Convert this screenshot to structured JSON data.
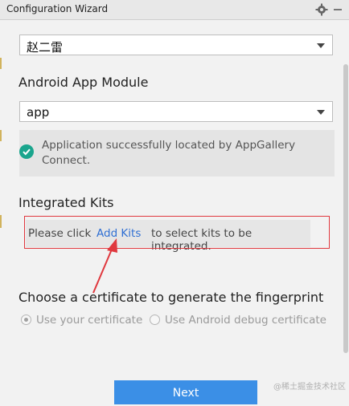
{
  "window": {
    "title": "Configuration Wizard"
  },
  "developer_select": {
    "value": "赵二雷"
  },
  "module": {
    "label": "Android App Module",
    "value": "app"
  },
  "notice": {
    "text": "Application successfully located by AppGallery Connect."
  },
  "kits": {
    "label": "Integrated Kits",
    "prefix": "Please click",
    "link": "Add Kits",
    "suffix": "to select kits to be integrated."
  },
  "certificate": {
    "title": "Choose a certificate to generate the fingerprint",
    "options": [
      {
        "label": "Use your certificate",
        "selected": true
      },
      {
        "label": "Use Android debug certificate",
        "selected": false
      }
    ]
  },
  "footer": {
    "next_label": "Next"
  },
  "watermark": "@稀土掘金技术社区",
  "colors": {
    "accent": "#3b8fe6",
    "success": "#1aa58d",
    "highlight": "#e0383e",
    "link": "#2f6fd3"
  },
  "icons": [
    "gear-icon",
    "minimize-icon",
    "check-circle-icon",
    "chevron-down-icon"
  ]
}
